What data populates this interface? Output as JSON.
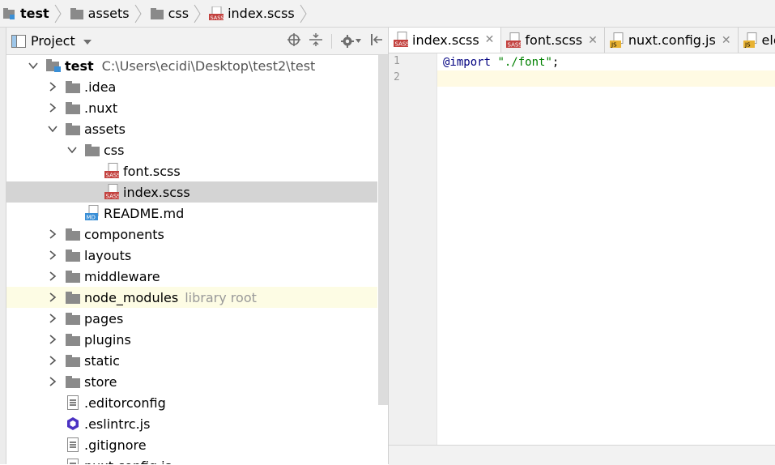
{
  "breadcrumb": [
    {
      "label": "test",
      "icon": "project-icon",
      "bold": true
    },
    {
      "label": "assets",
      "icon": "folder-icon",
      "bold": false
    },
    {
      "label": "css",
      "icon": "folder-icon",
      "bold": false
    },
    {
      "label": "index.scss",
      "icon": "sass-file-icon",
      "bold": false
    }
  ],
  "project_panel": {
    "title": "Project",
    "tree": [
      {
        "label": "test",
        "path": "C:\\Users\\ecidi\\Desktop\\test2\\test",
        "depth": 0,
        "arrow": "down",
        "icon": "project-folder",
        "bold": true
      },
      {
        "label": ".idea",
        "depth": 1,
        "arrow": "right",
        "icon": "folder"
      },
      {
        "label": ".nuxt",
        "depth": 1,
        "arrow": "right",
        "icon": "folder"
      },
      {
        "label": "assets",
        "depth": 1,
        "arrow": "down",
        "icon": "folder"
      },
      {
        "label": "css",
        "depth": 2,
        "arrow": "down",
        "icon": "folder"
      },
      {
        "label": "font.scss",
        "depth": 3,
        "arrow": "none",
        "icon": "sass"
      },
      {
        "label": "index.scss",
        "depth": 3,
        "arrow": "none",
        "icon": "sass",
        "selected": true
      },
      {
        "label": "README.md",
        "depth": 2,
        "arrow": "none",
        "icon": "md"
      },
      {
        "label": "components",
        "depth": 1,
        "arrow": "right",
        "icon": "folder"
      },
      {
        "label": "layouts",
        "depth": 1,
        "arrow": "right",
        "icon": "folder"
      },
      {
        "label": "middleware",
        "depth": 1,
        "arrow": "right",
        "icon": "folder"
      },
      {
        "label": "node_modules",
        "suffix": "library root",
        "depth": 1,
        "arrow": "right",
        "icon": "folder",
        "highlighted": true
      },
      {
        "label": "pages",
        "depth": 1,
        "arrow": "right",
        "icon": "folder"
      },
      {
        "label": "plugins",
        "depth": 1,
        "arrow": "right",
        "icon": "folder"
      },
      {
        "label": "static",
        "depth": 1,
        "arrow": "right",
        "icon": "folder"
      },
      {
        "label": "store",
        "depth": 1,
        "arrow": "right",
        "icon": "folder"
      },
      {
        "label": ".editorconfig",
        "depth": 1,
        "arrow": "none",
        "icon": "text"
      },
      {
        "label": ".eslintrc.js",
        "depth": 1,
        "arrow": "none",
        "icon": "eslint"
      },
      {
        "label": ".gitignore",
        "depth": 1,
        "arrow": "none",
        "icon": "text"
      },
      {
        "label": "nuxt.config.js",
        "depth": 1,
        "arrow": "none",
        "icon": "text"
      }
    ]
  },
  "editor": {
    "tabs": [
      {
        "label": "index.scss",
        "icon": "sass",
        "active": true
      },
      {
        "label": "font.scss",
        "icon": "sass",
        "active": false
      },
      {
        "label": "nuxt.config.js",
        "icon": "js",
        "active": false
      },
      {
        "label": "eleme",
        "icon": "js",
        "active": false
      }
    ],
    "line_numbers": [
      "1",
      "2"
    ],
    "code_line1_keyword": "@import",
    "code_line1_string": "\"./font\"",
    "code_line1_end": ";"
  },
  "colors": {
    "folder": "#8a8a8a",
    "sass": "#c3423f",
    "js": "#e8b232",
    "eslint": "#4b32c3",
    "selection": "#d4d4d4",
    "library_highlight": "#fdfce4",
    "current_line": "#fffae3"
  }
}
